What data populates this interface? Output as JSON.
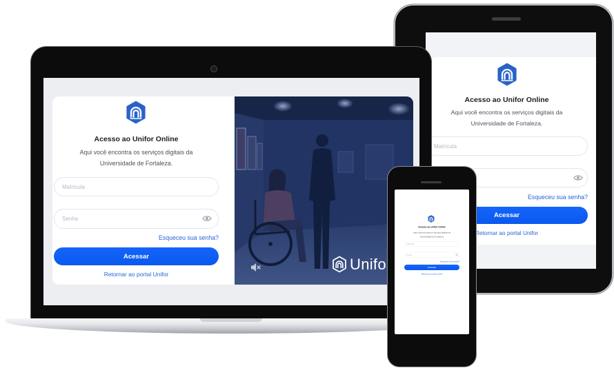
{
  "login": {
    "logo_icon": "unifor-logo-icon",
    "title": "Acesso ao Unifor Online",
    "subtitle_line1": "Aqui você encontra os serviços digitais da",
    "subtitle_line2": "Universidade de Fortaleza.",
    "username": {
      "placeholder": "Matrícula"
    },
    "password": {
      "placeholder": "Senha",
      "toggle_icon": "eye-icon"
    },
    "forgot_link": "Esqueceu sua senha?",
    "submit_label": "Acessar",
    "return_link": "Retornar ao portal Unifor"
  },
  "hero": {
    "brand_icon": "unifor-logo-icon",
    "brand_wordmark": "Unifor",
    "mute_icon": "volume-mute-icon"
  },
  "colors": {
    "primary_button": "#0b5cf5",
    "link": "#2563d8",
    "logo": "#2a63c8",
    "screen_background": "#eceef1",
    "device_frame": "#0d0d0e"
  }
}
